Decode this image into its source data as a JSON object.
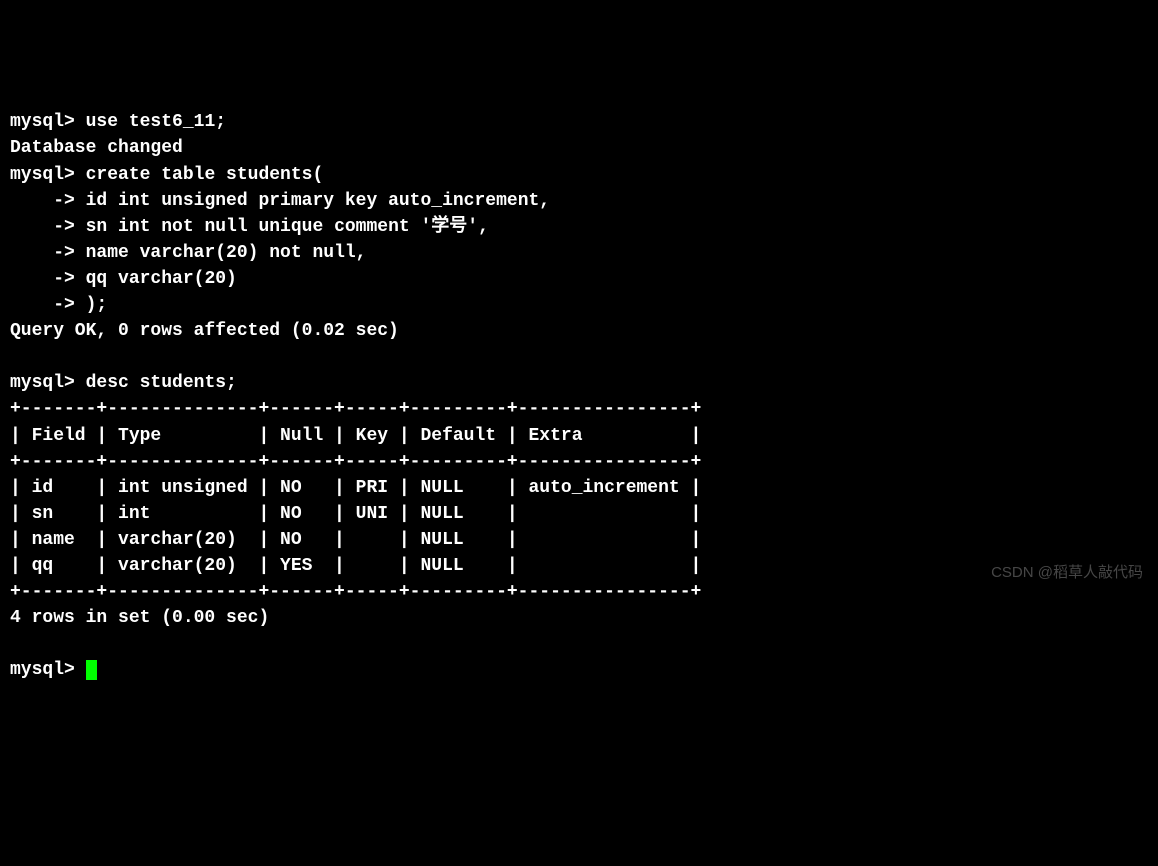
{
  "session": {
    "prompt": "mysql>",
    "cont": "    ->",
    "cmd_use": "use test6_11;",
    "msg_db_changed": "Database changed",
    "cmd_create_l1": "create table students(",
    "cmd_create_l2": "id int unsigned primary key auto_increment,",
    "cmd_create_l3": "sn int not null unique comment '学号',",
    "cmd_create_l4": "name varchar(20) not null,",
    "cmd_create_l5": "qq varchar(20)",
    "cmd_create_l6": ");",
    "msg_query_ok": "Query OK, 0 rows affected (0.02 sec)",
    "cmd_desc": "desc students;",
    "msg_rows": "4 rows in set (0.00 sec)"
  },
  "table": {
    "border": "+-------+--------------+------+-----+---------+----------------+",
    "header": "| Field | Type         | Null | Key | Default | Extra          |",
    "rows": [
      "| id    | int unsigned | NO   | PRI | NULL    | auto_increment |",
      "| sn    | int          | NO   | UNI | NULL    |                |",
      "| name  | varchar(20)  | NO   |     | NULL    |                |",
      "| qq    | varchar(20)  | YES  |     | NULL    |                |"
    ]
  },
  "desc_table": {
    "columns": [
      "Field",
      "Type",
      "Null",
      "Key",
      "Default",
      "Extra"
    ],
    "data": [
      {
        "Field": "id",
        "Type": "int unsigned",
        "Null": "NO",
        "Key": "PRI",
        "Default": "NULL",
        "Extra": "auto_increment"
      },
      {
        "Field": "sn",
        "Type": "int",
        "Null": "NO",
        "Key": "UNI",
        "Default": "NULL",
        "Extra": ""
      },
      {
        "Field": "name",
        "Type": "varchar(20)",
        "Null": "NO",
        "Key": "",
        "Default": "NULL",
        "Extra": ""
      },
      {
        "Field": "qq",
        "Type": "varchar(20)",
        "Null": "YES",
        "Key": "",
        "Default": "NULL",
        "Extra": ""
      }
    ]
  },
  "watermark": "CSDN @稻草人敲代码"
}
